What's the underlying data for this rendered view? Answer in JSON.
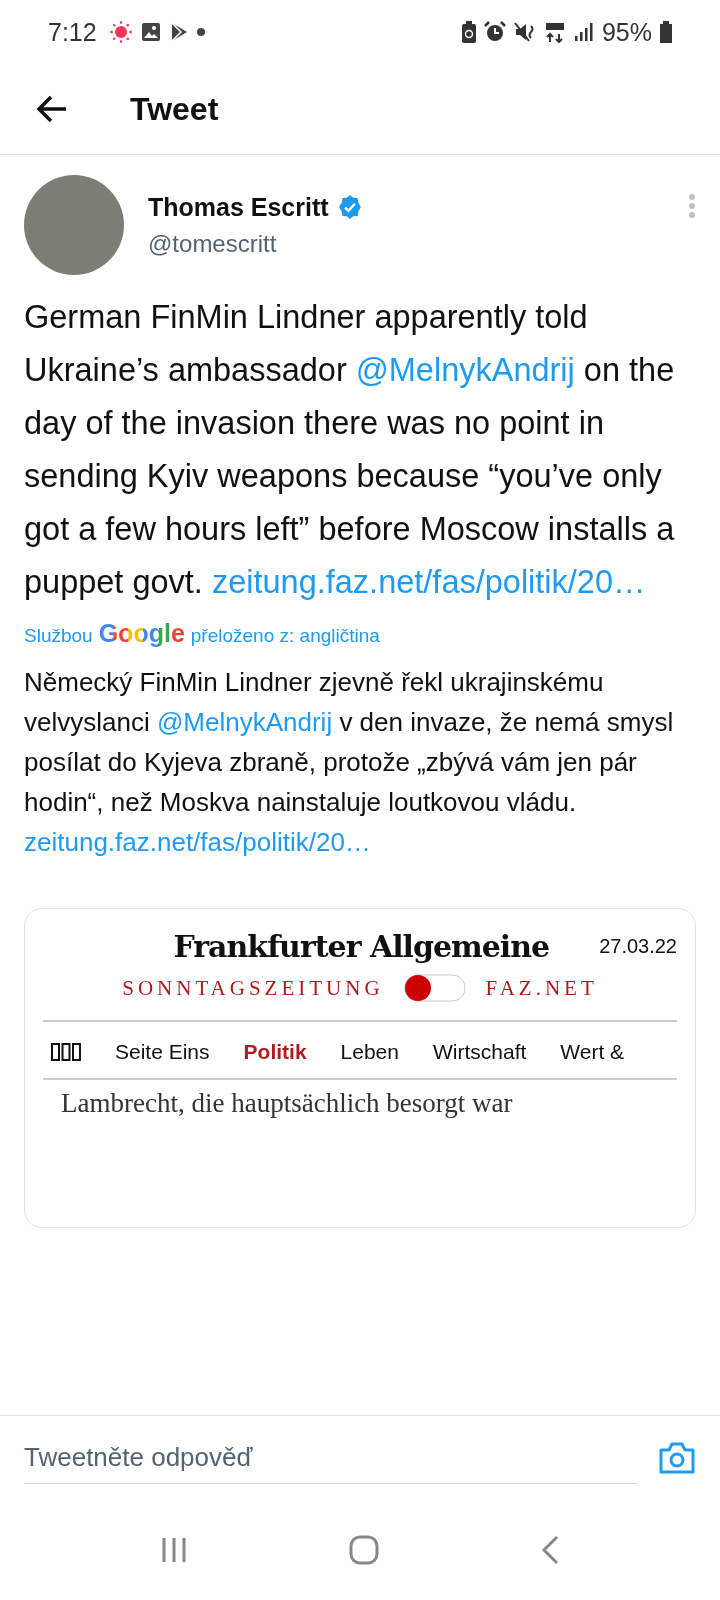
{
  "status_bar": {
    "time": "7:12",
    "battery": "95%"
  },
  "header": {
    "title": "Tweet"
  },
  "tweet": {
    "author": {
      "name": "Thomas Escritt",
      "handle": "@tomescritt",
      "verified": true
    },
    "text": [
      {
        "kind": "text",
        "text": "German FinMin Lindner apparently told Ukraine’s ambassador "
      },
      {
        "kind": "link",
        "text": "@MelnykAndrij"
      },
      {
        "kind": "text",
        "text": " on the day of the invasion there was no point in sending Kyiv weapons because “you’ve only got a few hours left” before Moscow installs a puppet govt. "
      },
      {
        "kind": "link",
        "text": "zeitung.faz.net/fas/politik/20…"
      }
    ],
    "translation_note": {
      "prefix": "Službou",
      "brand": "Google",
      "suffix": "přeloženo z: angličtina"
    },
    "translation": [
      {
        "kind": "text",
        "text": "Německý FinMin Lindner zjevně řekl ukrajinskému velvyslanci "
      },
      {
        "kind": "link",
        "text": " @MelnykAndrij "
      },
      {
        "kind": "text",
        "text": " v den invaze, že nemá smysl posílat do Kyjeva zbraně, protože „zbývá vám jen pár hodin“, než Moskva nainstaluje loutkovou vládu. "
      },
      {
        "kind": "link",
        "text": "zeitung.faz.net/fas/politik/20…"
      }
    ],
    "image": {
      "masthead": "Frankfurter Allgemeine",
      "date": "27.03.22",
      "edition_left": "SONNTAGSZEITUNG",
      "edition_right": "FAZ.NET",
      "nav": [
        {
          "label": "Seite Eins",
          "selected": false
        },
        {
          "label": "Politik",
          "selected": true
        },
        {
          "label": "Leben",
          "selected": false
        },
        {
          "label": "Wirtschaft",
          "selected": false
        },
        {
          "label": "Wert &",
          "selected": false
        }
      ],
      "article_line": "Lambrecht, die hauptsächlich besorgt war"
    }
  },
  "reply": {
    "placeholder": "Tweetněte odpověď"
  }
}
